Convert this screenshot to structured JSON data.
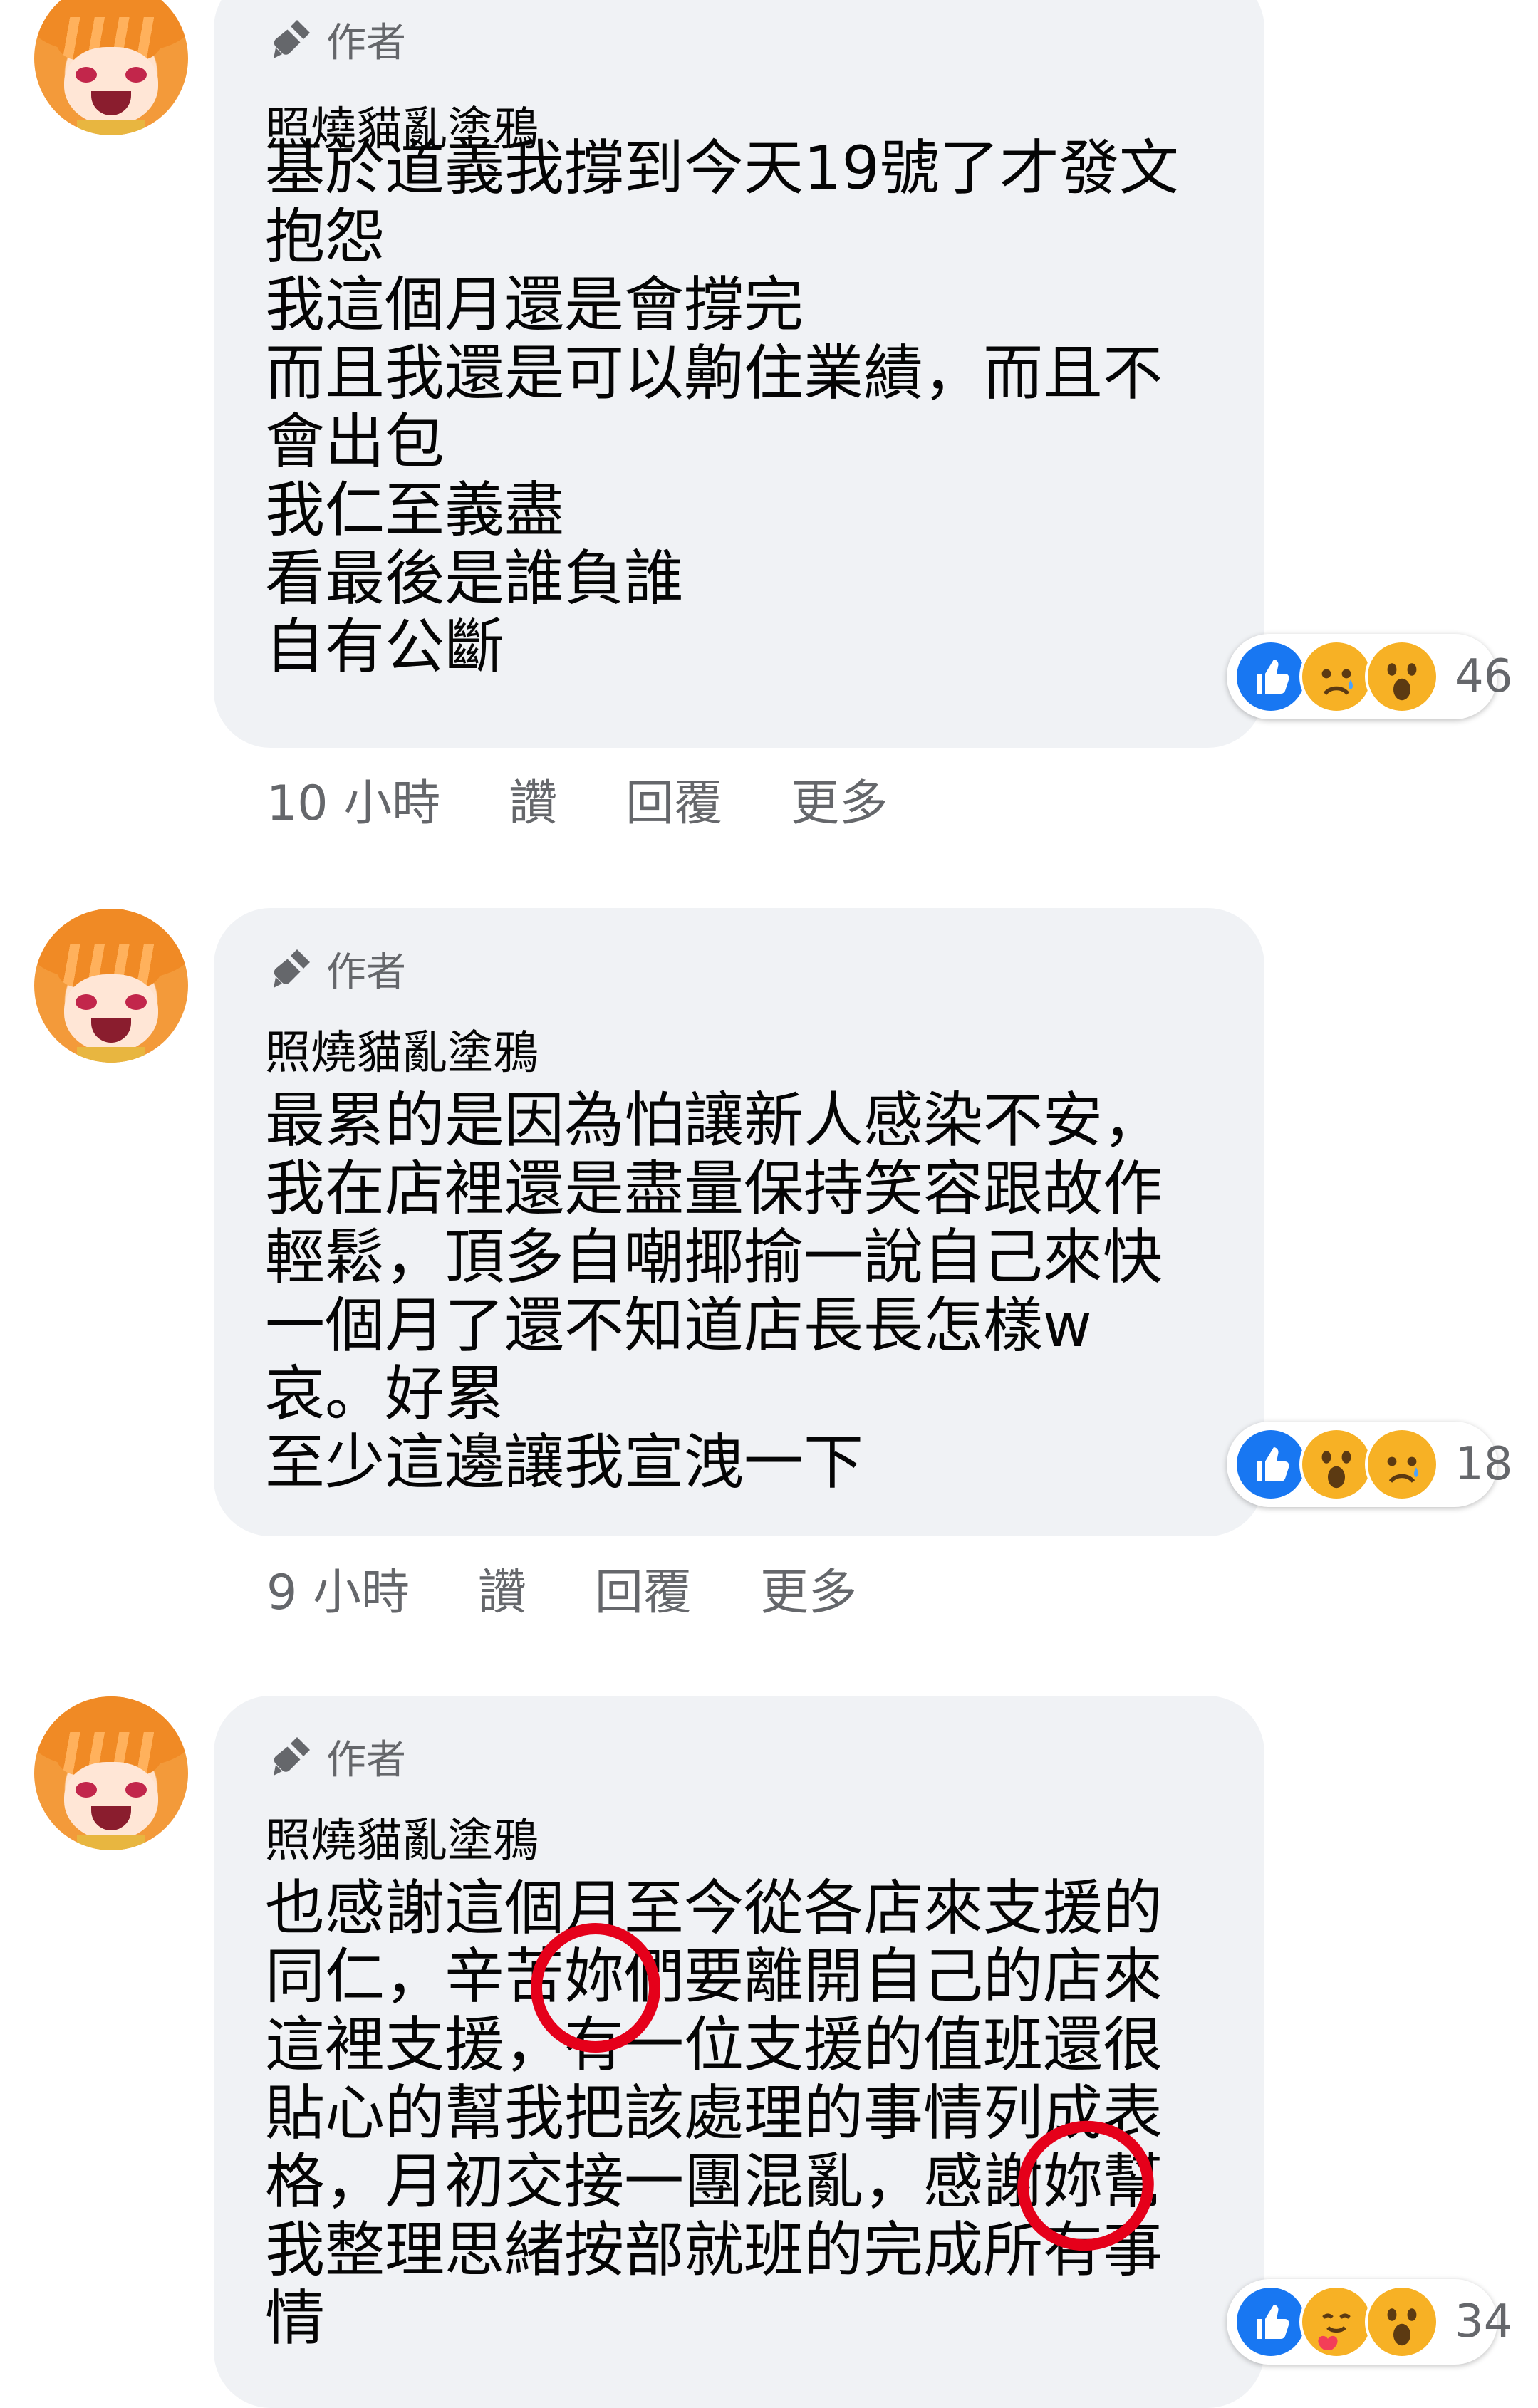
{
  "comments": [
    {
      "badge": "作者",
      "author": "照燒貓亂塗鴉",
      "lines": [
        "基於道義我撐到今天19號了才發文",
        "抱怨",
        "我這個月還是會撐完",
        "而且我還是可以齁住業績，而且不",
        "會出包",
        "我仁至義盡",
        "看最後是誰負誰",
        "自有公斷"
      ],
      "reactions": {
        "icons": [
          "like-icon",
          "sad-icon",
          "wow-icon"
        ],
        "count": "46"
      },
      "time": "10 小時",
      "like_label": "讚",
      "reply_label": "回覆",
      "more_label": "更多"
    },
    {
      "badge": "作者",
      "author": "照燒貓亂塗鴉",
      "lines": [
        "最累的是因為怕讓新人感染不安，",
        "我在店裡還是盡量保持笑容跟故作",
        "輕鬆，頂多自嘲揶揄一說自己來快",
        "一個月了還不知道店長長怎樣w",
        "哀。好累",
        "至少這邊讓我宣洩一下"
      ],
      "reactions": {
        "icons": [
          "like-icon",
          "wow-icon",
          "sad-icon"
        ],
        "count": "18"
      },
      "time": "9 小時",
      "like_label": "讚",
      "reply_label": "回覆",
      "more_label": "更多"
    },
    {
      "badge": "作者",
      "author": "照燒貓亂塗鴉",
      "lines": [
        "也感謝這個月至今從各店來支援的",
        "同仁，辛苦妳們要離開自己的店來",
        "這裡支援，有一位支援的值班還很",
        "貼心的幫我把該處理的事情列成表",
        "格，月初交接一團混亂，感謝妳幫",
        "我整理思緒按部就班的完成所有事",
        "情"
      ],
      "reactions": {
        "icons": [
          "like-icon",
          "care-icon",
          "wow-icon"
        ],
        "count": "34"
      }
    }
  ],
  "colors": {
    "bubble": "#f0f2f5",
    "meta_text": "#65676b",
    "like_blue": "#1877f2",
    "emoji_yellow": "#f7b125",
    "annotation_red": "#e5001a"
  }
}
